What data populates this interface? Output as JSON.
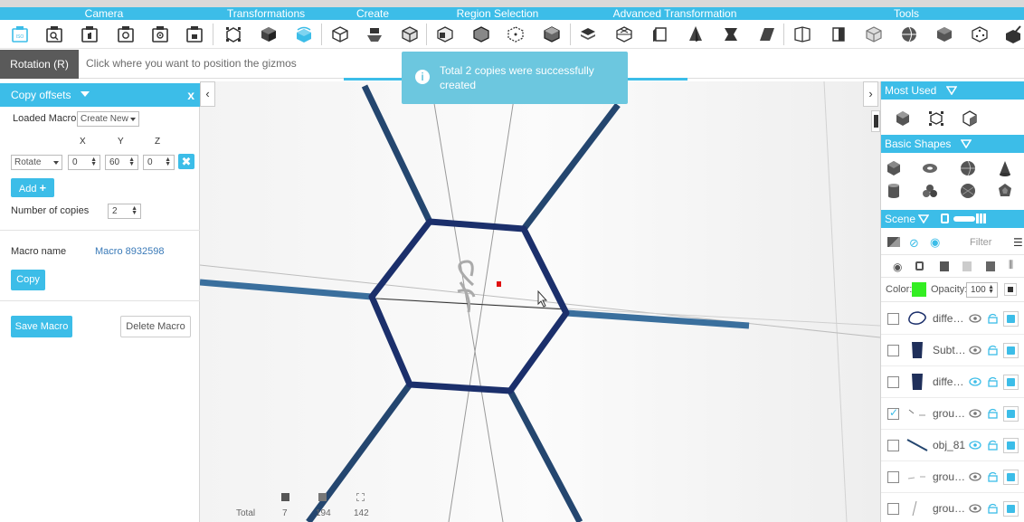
{
  "categories": [
    "Camera",
    "Transformations",
    "Create",
    "Region Selection",
    "Advanced Transformation",
    "Tools"
  ],
  "hint": {
    "mode": "Rotation (R)",
    "text": "Click where you want to position the gizmos"
  },
  "toast": {
    "icon": "info-icon",
    "message": "Total 2 copies were successfully created"
  },
  "left_panel": {
    "title": "Copy offsets",
    "close": "x",
    "loaded_macro_label": "Loaded Macro",
    "loaded_macro_value": "Create New",
    "axis_labels": [
      "X",
      "Y",
      "Z"
    ],
    "operation": "Rotate",
    "x": "0",
    "y": "60",
    "z": "0",
    "add_label": "Add",
    "copies_label": "Number of copies",
    "copies_value": "2",
    "macro_name_label": "Macro name",
    "macro_name_value": "Macro 8932598",
    "copy_label": "Copy",
    "save_macro_label": "Save Macro",
    "delete_macro_label": "Delete Macro"
  },
  "viewport": {
    "stats": {
      "total_label": "Total",
      "values": [
        "7",
        "194",
        "142"
      ]
    }
  },
  "right_panel": {
    "most_used": "Most Used",
    "basic_shapes": "Basic Shapes",
    "scene": "Scene",
    "filter_placeholder": "Filter",
    "color_label": "Color:",
    "color_value": "#33ee22",
    "opacity_label": "Opacity:",
    "opacity_value": "100",
    "scene_items": [
      {
        "name": "diffe…",
        "checked": false
      },
      {
        "name": "Subt…",
        "checked": false
      },
      {
        "name": "diffe…",
        "checked": false
      },
      {
        "name": "grou…",
        "checked": true
      },
      {
        "name": "obj_81",
        "checked": false
      },
      {
        "name": "grou…",
        "checked": false
      },
      {
        "name": "grou…",
        "checked": false
      }
    ]
  },
  "colors": {
    "accent": "#3cbde8",
    "toast": "#6cc7df",
    "mode_chip": "#5a5a5a",
    "hexagon": "#1b2f6b",
    "struts": "#24466f",
    "axis_bar": "#3a6f9d"
  }
}
